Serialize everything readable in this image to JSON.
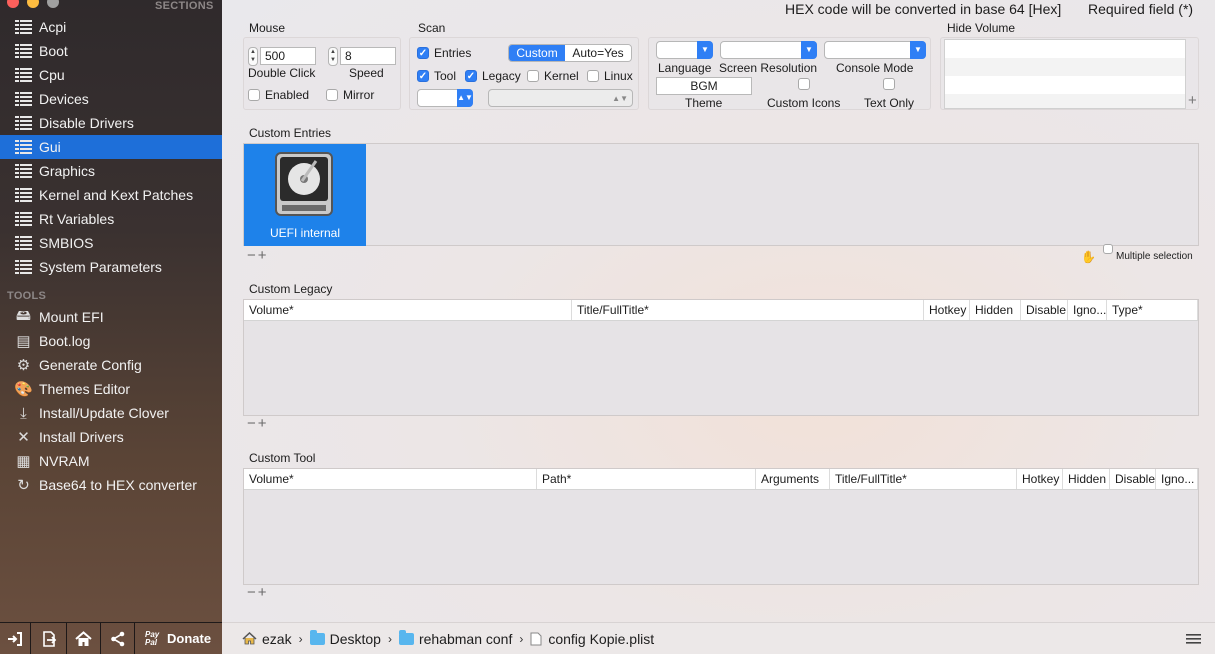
{
  "sidebar": {
    "sections_header": "SECTIONS",
    "tools_header": "TOOLS",
    "items": [
      {
        "label": "Acpi",
        "icon": "list-icon"
      },
      {
        "label": "Boot",
        "icon": "list-icon"
      },
      {
        "label": "Cpu",
        "icon": "list-icon"
      },
      {
        "label": "Devices",
        "icon": "list-icon"
      },
      {
        "label": "Disable Drivers",
        "icon": "list-icon"
      },
      {
        "label": "Gui",
        "icon": "list-icon",
        "active": true
      },
      {
        "label": "Graphics",
        "icon": "list-icon"
      },
      {
        "label": "Kernel and Kext Patches",
        "icon": "list-icon"
      },
      {
        "label": "Rt Variables",
        "icon": "list-icon"
      },
      {
        "label": "SMBIOS",
        "icon": "list-icon"
      },
      {
        "label": "System Parameters",
        "icon": "list-icon"
      }
    ],
    "tools": [
      {
        "label": "Mount EFI",
        "icon": "disk-icon"
      },
      {
        "label": "Boot.log",
        "icon": "log-icon"
      },
      {
        "label": "Generate Config",
        "icon": "gears-icon"
      },
      {
        "label": "Themes Editor",
        "icon": "palette-icon"
      },
      {
        "label": "Install/Update Clover",
        "icon": "download-icon"
      },
      {
        "label": "Install Drivers",
        "icon": "tools-icon"
      },
      {
        "label": "NVRAM",
        "icon": "chip-icon"
      },
      {
        "label": "Base64 to HEX converter",
        "icon": "refresh-icon"
      }
    ],
    "bottom": {
      "donate_prefix": "Pay Pal",
      "donate_label": "Donate"
    },
    "accent": "#1e6fd9"
  },
  "header": {
    "hex_note": "HEX code will be converted in base 64 [Hex]",
    "required_note": "Required field (*)"
  },
  "mouse": {
    "title": "Mouse",
    "double_click_value": "500",
    "double_click_label": "Double Click",
    "speed_value": "8",
    "speed_label": "Speed",
    "enabled_label": "Enabled",
    "mirror_label": "Mirror"
  },
  "scan": {
    "title": "Scan",
    "entries_label": "Entries",
    "custom_label": "Custom",
    "auto_label": "Auto=Yes",
    "tool_label": "Tool",
    "legacy_label": "Legacy",
    "kernel_label": "Kernel",
    "linux_label": "Linux"
  },
  "theme_box": {
    "language_label": "Language",
    "resolution_label": "Screen Resolution",
    "console_label": "Console Mode",
    "theme_value": "BGM",
    "theme_label": "Theme",
    "custom_icons_label": "Custom Icons",
    "text_only_label": "Text Only"
  },
  "hide_volume": {
    "title": "Hide Volume"
  },
  "custom_entries": {
    "title": "Custom Entries",
    "entry_label": "UEFI internal",
    "multiple_selection_label": "Multiple selection"
  },
  "custom_legacy": {
    "title": "Custom Legacy",
    "columns": [
      "Volume*",
      "Title/FullTitle*",
      "Hotkey",
      "Hidden",
      "Disable",
      "Igno...",
      "Type*"
    ]
  },
  "custom_tool": {
    "title": "Custom Tool",
    "columns": [
      "Volume*",
      "Path*",
      "Arguments",
      "Title/FullTitle*",
      "Hotkey",
      "Hidden",
      "Disable",
      "Igno..."
    ]
  },
  "footer": {
    "crumbs": [
      "ezak",
      "Desktop",
      "rehabman conf",
      "config Kopie.plist"
    ]
  }
}
